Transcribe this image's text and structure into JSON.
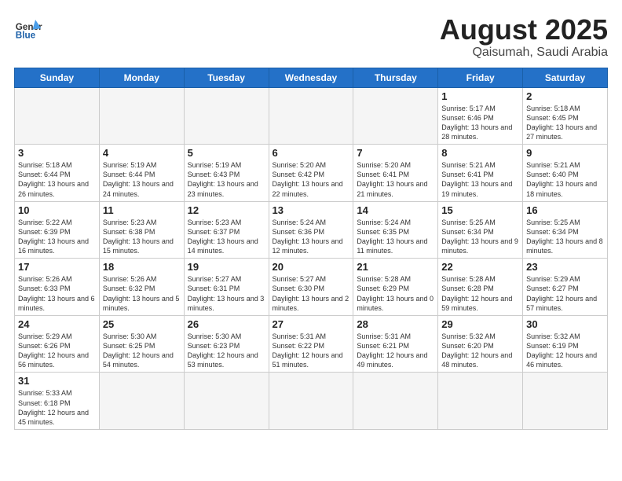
{
  "logo": {
    "general": "General",
    "blue": "Blue"
  },
  "title": "August 2025",
  "location": "Qaisumah, Saudi Arabia",
  "weekdays": [
    "Sunday",
    "Monday",
    "Tuesday",
    "Wednesday",
    "Thursday",
    "Friday",
    "Saturday"
  ],
  "weeks": [
    [
      {
        "day": "",
        "info": ""
      },
      {
        "day": "",
        "info": ""
      },
      {
        "day": "",
        "info": ""
      },
      {
        "day": "",
        "info": ""
      },
      {
        "day": "",
        "info": ""
      },
      {
        "day": "1",
        "info": "Sunrise: 5:17 AM\nSunset: 6:46 PM\nDaylight: 13 hours and 28 minutes."
      },
      {
        "day": "2",
        "info": "Sunrise: 5:18 AM\nSunset: 6:45 PM\nDaylight: 13 hours and 27 minutes."
      }
    ],
    [
      {
        "day": "3",
        "info": "Sunrise: 5:18 AM\nSunset: 6:44 PM\nDaylight: 13 hours and 26 minutes."
      },
      {
        "day": "4",
        "info": "Sunrise: 5:19 AM\nSunset: 6:44 PM\nDaylight: 13 hours and 24 minutes."
      },
      {
        "day": "5",
        "info": "Sunrise: 5:19 AM\nSunset: 6:43 PM\nDaylight: 13 hours and 23 minutes."
      },
      {
        "day": "6",
        "info": "Sunrise: 5:20 AM\nSunset: 6:42 PM\nDaylight: 13 hours and 22 minutes."
      },
      {
        "day": "7",
        "info": "Sunrise: 5:20 AM\nSunset: 6:41 PM\nDaylight: 13 hours and 21 minutes."
      },
      {
        "day": "8",
        "info": "Sunrise: 5:21 AM\nSunset: 6:41 PM\nDaylight: 13 hours and 19 minutes."
      },
      {
        "day": "9",
        "info": "Sunrise: 5:21 AM\nSunset: 6:40 PM\nDaylight: 13 hours and 18 minutes."
      }
    ],
    [
      {
        "day": "10",
        "info": "Sunrise: 5:22 AM\nSunset: 6:39 PM\nDaylight: 13 hours and 16 minutes."
      },
      {
        "day": "11",
        "info": "Sunrise: 5:23 AM\nSunset: 6:38 PM\nDaylight: 13 hours and 15 minutes."
      },
      {
        "day": "12",
        "info": "Sunrise: 5:23 AM\nSunset: 6:37 PM\nDaylight: 13 hours and 14 minutes."
      },
      {
        "day": "13",
        "info": "Sunrise: 5:24 AM\nSunset: 6:36 PM\nDaylight: 13 hours and 12 minutes."
      },
      {
        "day": "14",
        "info": "Sunrise: 5:24 AM\nSunset: 6:35 PM\nDaylight: 13 hours and 11 minutes."
      },
      {
        "day": "15",
        "info": "Sunrise: 5:25 AM\nSunset: 6:34 PM\nDaylight: 13 hours and 9 minutes."
      },
      {
        "day": "16",
        "info": "Sunrise: 5:25 AM\nSunset: 6:34 PM\nDaylight: 13 hours and 8 minutes."
      }
    ],
    [
      {
        "day": "17",
        "info": "Sunrise: 5:26 AM\nSunset: 6:33 PM\nDaylight: 13 hours and 6 minutes."
      },
      {
        "day": "18",
        "info": "Sunrise: 5:26 AM\nSunset: 6:32 PM\nDaylight: 13 hours and 5 minutes."
      },
      {
        "day": "19",
        "info": "Sunrise: 5:27 AM\nSunset: 6:31 PM\nDaylight: 13 hours and 3 minutes."
      },
      {
        "day": "20",
        "info": "Sunrise: 5:27 AM\nSunset: 6:30 PM\nDaylight: 13 hours and 2 minutes."
      },
      {
        "day": "21",
        "info": "Sunrise: 5:28 AM\nSunset: 6:29 PM\nDaylight: 13 hours and 0 minutes."
      },
      {
        "day": "22",
        "info": "Sunrise: 5:28 AM\nSunset: 6:28 PM\nDaylight: 12 hours and 59 minutes."
      },
      {
        "day": "23",
        "info": "Sunrise: 5:29 AM\nSunset: 6:27 PM\nDaylight: 12 hours and 57 minutes."
      }
    ],
    [
      {
        "day": "24",
        "info": "Sunrise: 5:29 AM\nSunset: 6:26 PM\nDaylight: 12 hours and 56 minutes."
      },
      {
        "day": "25",
        "info": "Sunrise: 5:30 AM\nSunset: 6:25 PM\nDaylight: 12 hours and 54 minutes."
      },
      {
        "day": "26",
        "info": "Sunrise: 5:30 AM\nSunset: 6:23 PM\nDaylight: 12 hours and 53 minutes."
      },
      {
        "day": "27",
        "info": "Sunrise: 5:31 AM\nSunset: 6:22 PM\nDaylight: 12 hours and 51 minutes."
      },
      {
        "day": "28",
        "info": "Sunrise: 5:31 AM\nSunset: 6:21 PM\nDaylight: 12 hours and 49 minutes."
      },
      {
        "day": "29",
        "info": "Sunrise: 5:32 AM\nSunset: 6:20 PM\nDaylight: 12 hours and 48 minutes."
      },
      {
        "day": "30",
        "info": "Sunrise: 5:32 AM\nSunset: 6:19 PM\nDaylight: 12 hours and 46 minutes."
      }
    ],
    [
      {
        "day": "31",
        "info": "Sunrise: 5:33 AM\nSunset: 6:18 PM\nDaylight: 12 hours and 45 minutes."
      },
      {
        "day": "",
        "info": ""
      },
      {
        "day": "",
        "info": ""
      },
      {
        "day": "",
        "info": ""
      },
      {
        "day": "",
        "info": ""
      },
      {
        "day": "",
        "info": ""
      },
      {
        "day": "",
        "info": ""
      }
    ]
  ]
}
